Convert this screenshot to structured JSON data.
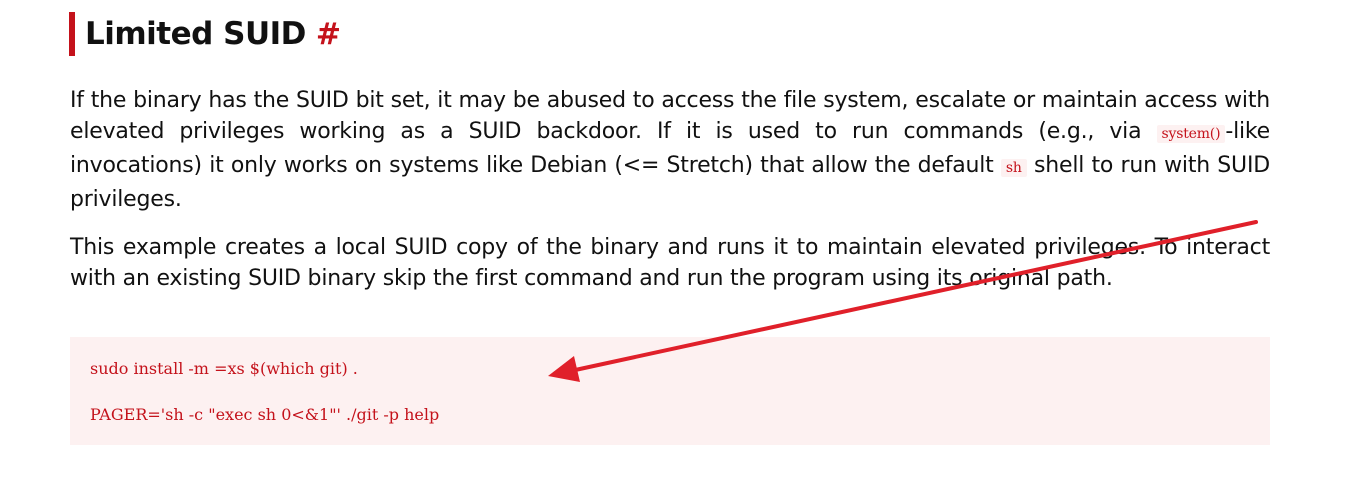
{
  "section": {
    "title": "Limited SUID",
    "anchor": "#"
  },
  "paragraph1": {
    "part1": "If the binary has the SUID bit set, it may be abused to access the file system, escalate or maintain access with elevated privileges working as a SUID backdoor. If it is used to run commands (e.g., via ",
    "code1": "system()",
    "part2": "-like invocations) it only works on systems like Debian (<= Stretch) that allow the default ",
    "code2": "sh",
    "part3": " shell to run with SUID privileges."
  },
  "paragraph2": {
    "text": "This example creates a local SUID copy of the binary and runs it to maintain elevated privileges. To interact with an existing SUID binary skip the first command and run the program using its original path."
  },
  "code_block": {
    "line1": "sudo install -m =xs $(which git) .",
    "line2": "PAGER='sh -c \"exec sh 0<&1\"' ./git -p help"
  },
  "annotation": {
    "arrow_color": "#e0202a"
  }
}
